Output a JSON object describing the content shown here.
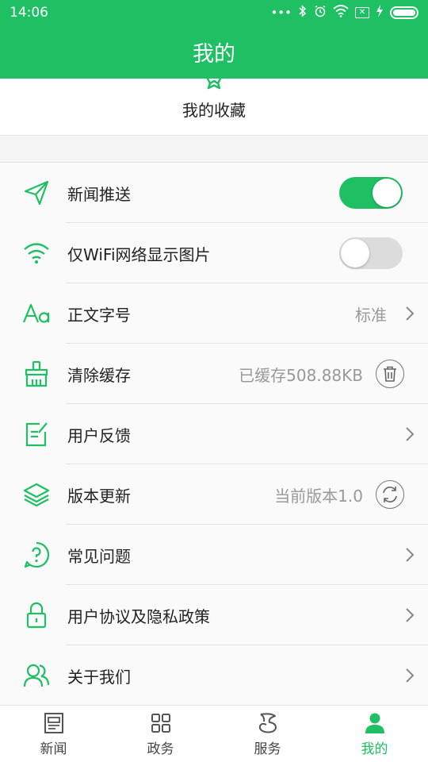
{
  "status_bar": {
    "time": "14:06"
  },
  "header": {
    "title": "我的"
  },
  "favorites": {
    "label": "我的收藏"
  },
  "colors": {
    "accent": "#1fbf63",
    "text": "#222222",
    "muted": "#999999"
  },
  "settings": [
    {
      "label": "新闻推送",
      "icon": "paper-plane-icon",
      "control": "toggle",
      "on": true
    },
    {
      "label": "仅WiFi网络显示图片",
      "icon": "wifi-icon",
      "control": "toggle",
      "on": false
    },
    {
      "label": "正文字号",
      "icon": "font-size-icon",
      "value": "标准",
      "control": "chevron"
    },
    {
      "label": "清除缓存",
      "icon": "broom-icon",
      "value": "已缓存508.88KB",
      "control": "trash-button"
    },
    {
      "label": "用户反馈",
      "icon": "feedback-icon",
      "control": "chevron"
    },
    {
      "label": "版本更新",
      "icon": "layers-icon",
      "value": "当前版本1.0",
      "control": "refresh-button"
    },
    {
      "label": "常见问题",
      "icon": "question-icon",
      "control": "chevron"
    },
    {
      "label": "用户协议及隐私政策",
      "icon": "lock-icon",
      "control": "chevron"
    },
    {
      "label": "关于我们",
      "icon": "users-icon",
      "control": "chevron"
    }
  ],
  "tabs": [
    {
      "label": "新闻",
      "icon": "news-icon",
      "active": false
    },
    {
      "label": "政务",
      "icon": "grid-icon",
      "active": false
    },
    {
      "label": "服务",
      "icon": "service-icon",
      "active": false
    },
    {
      "label": "我的",
      "icon": "person-icon",
      "active": true
    }
  ]
}
